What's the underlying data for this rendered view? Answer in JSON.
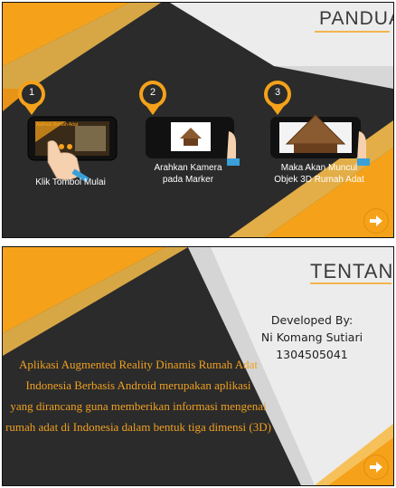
{
  "panduan": {
    "title": "PANDUAN",
    "steps": [
      {
        "number": "1",
        "label_lines": [
          "Klik Tombol Mulai"
        ],
        "screen_text": "Aplikasi Rumah Adat"
      },
      {
        "number": "2",
        "label_lines": [
          "Arahkan Kamera",
          "pada Marker"
        ]
      },
      {
        "number": "3",
        "label_lines": [
          "Maka Akan Muncul",
          "Objek 3D Rumah Adat"
        ]
      }
    ],
    "next_icon": "arrow-right-icon"
  },
  "tentang": {
    "title": "TENTANG",
    "description_lines": [
      "Aplikasi Augmented Reality Dinamis Rumah Adat",
      "Indonesia Berbasis Android merupakan aplikasi",
      "yang dirancang guna memberikan informasi mengenai",
      "rumah adat di Indonesia dalam bentuk tiga dimensi (3D)"
    ],
    "developer": {
      "heading": "Developed By:",
      "name": "Ni Komang Sutiari",
      "id": "1304505041"
    },
    "next_icon": "arrow-right-icon"
  },
  "colors": {
    "dark": "#2b2b2b",
    "orange": "#f5a21a",
    "orange_light": "#f7bd4a",
    "light_gray": "#ececec"
  }
}
